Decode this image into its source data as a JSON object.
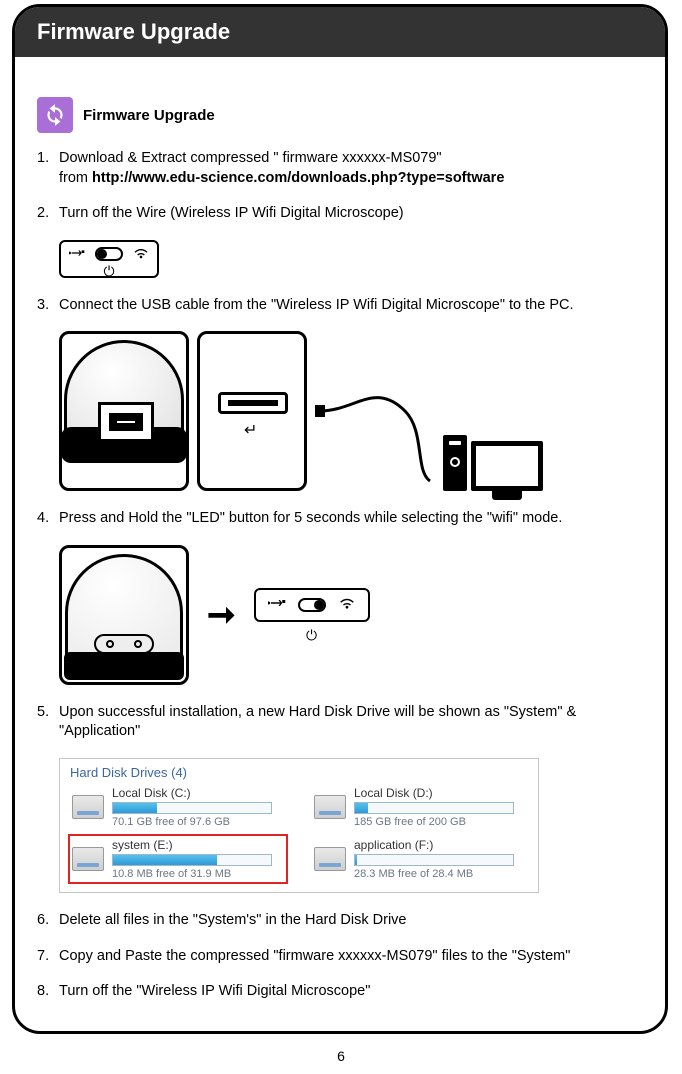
{
  "header": {
    "title": "Firmware Upgrade"
  },
  "section": {
    "label": "Firmware Upgrade"
  },
  "steps": {
    "1": {
      "num": "1.",
      "line1": "Download & Extract compressed \" firmware xxxxxx-MS079\"",
      "line2a": "from ",
      "line2b": "http://www.edu-science.com/downloads.php?type=software"
    },
    "2": {
      "num": "2.",
      "text": "Turn off the Wire (Wireless IP Wifi Digital Microscope)"
    },
    "3": {
      "num": "3.",
      "text": "Connect the USB cable from the \"Wireless IP Wifi Digital Microscope\" to the PC."
    },
    "4": {
      "num": "4.",
      "text": "Press and Hold the \"LED\" button for 5 seconds while selecting the \"wifi\" mode."
    },
    "5": {
      "num": "5.",
      "text": "Upon successful installation, a new Hard Disk Drive will be shown as \"System\" & \"Application\""
    },
    "6": {
      "num": "6.",
      "text": "Delete all files in the \"System's\" in the Hard Disk Drive"
    },
    "7": {
      "num": "7.",
      "text": "Copy and Paste the compressed \"firmware xxxxxx-MS079\" files to the \"System\""
    },
    "8": {
      "num": "8.",
      "text": "Turn off the \"Wireless IP Wifi Digital Microscope\""
    }
  },
  "glyphs": {
    "usb": "⊷",
    "wifi": "⊜",
    "power": "⏻",
    "arrow_right": "→",
    "thick_arrow": "➞"
  },
  "drives": {
    "heading": "Hard Disk Drives (4)",
    "items": [
      {
        "name": "Local Disk (C:)",
        "free": "70.1 GB free of 97.6 GB",
        "fill_pct": 28,
        "highlight": false
      },
      {
        "name": "Local Disk (D:)",
        "free": "185 GB free of 200 GB",
        "fill_pct": 8,
        "highlight": false
      },
      {
        "name": "system (E:)",
        "free": "10.8 MB free of 31.9 MB",
        "fill_pct": 66,
        "highlight": true
      },
      {
        "name": "application (F:)",
        "free": "28.3 MB free of 28.4 MB",
        "fill_pct": 1,
        "highlight": false
      }
    ]
  },
  "page_number": "6"
}
